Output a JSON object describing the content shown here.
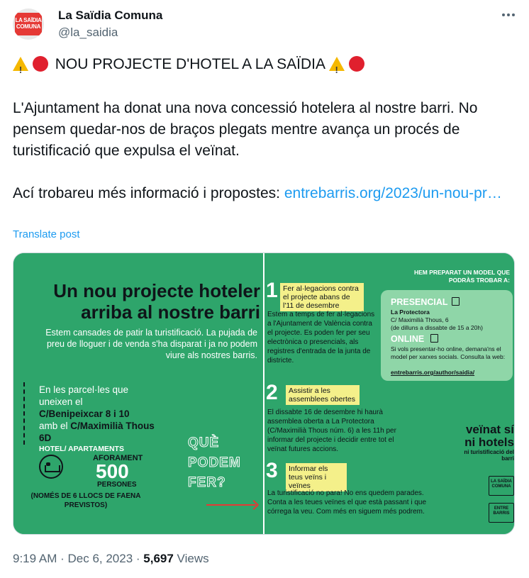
{
  "author": {
    "display_name": "La Saïdia Comuna",
    "handle": "@la_saidia",
    "avatar_text": "LA SAÏDIA COMUNA"
  },
  "post": {
    "title": "NOU PROJECTE D'HOTEL A LA SAÏDIA",
    "paragraph1": "L'Ajuntament ha donat una nova concessió hotelera al nostre barri. No pensem quedar-nos de braços plegats mentre avança un procés de turistificació que expulsa el veïnat.",
    "paragraph2_prefix": "Ací trobareu més informació i propostes: ",
    "link_text": "entrebarris.org/2023/un-nou-pr…",
    "translate_label": "Translate post"
  },
  "image": {
    "left": {
      "title_line1": "Un nou projecte hoteler",
      "title_line2": "arriba al nostre barri",
      "intro": "Estem cansades de patir la turistificació. La pujada de preu de lloguer i de venda s'ha disparat i ja no podem viure als nostres barris.",
      "loc_intro": "En les parcel·les que uneixen el",
      "loc_street1": "C/Benipeixcar 8 i 10",
      "loc_amb": "amb el",
      "loc_street2": "C/Maximilià Thous 6D",
      "hotel_label": "HOTEL/ APARTAMENTS",
      "aforament": "AFORAMENT",
      "count": "500",
      "persones": "PERSONES",
      "jobs": "(NOMÉS DE 6 LLOCS DE FAENA PREVISTOS)",
      "que1": "QUÈ",
      "que2": "PODEM",
      "que3": "FER?"
    },
    "right": {
      "hem": "HEM PREPARAT UN MODEL QUE PODRÀS TROBAR A:",
      "step1_num": "1",
      "step1_tag": "Fer al·legacions contra el projecte abans de l'11 de desembre",
      "step1_text": "Estem a temps de fer al·legacions a l'Ajuntament de València contra el projecte. Es poden fer per seu electrònica o presencials, als registres d'entrada de la junta de districte.",
      "step2_num": "2",
      "step2_tag": "Assistir a les assemblees obertes",
      "step2_text": "El dissabte 16 de desembre hi haurà assemblea oberta a La Protectora (C/Maximilià Thous núm. 6) a les 11h per informar del projecte i decidir entre tot el veïnat futures accions.",
      "step3_num": "3",
      "step3_tag": "Informar els teus veïns i veïnes",
      "step3_text": "La turistificació no para! No ens quedem parades. Conta a les teues veïnes el que està passant i que córrega la veu. Com més en siguem més podrem.",
      "presencial_h": "PRESENCIAL",
      "presencial_t1": "La Protectora",
      "presencial_t2": "C/ Maximilià Thous, 6",
      "presencial_t3": "(de dilluns a dissabte de 15 a 20h)",
      "online_h": "ONLINE",
      "online_t": "Si vols presentar-ho online, demana'ns el model per xarxes socials. Consulta la web:",
      "online_link": "entrebarris.org/author/saidia/",
      "veinat1": "veïnat sí",
      "veinat2": "ni hotels",
      "veinat3": "ni turistificació del barri",
      "logo1": "LA SAÏDIA COMUNA",
      "logo2": "ENTRE BARRIS"
    }
  },
  "meta": {
    "time": "9:19 AM",
    "sep": " · ",
    "date": "Dec 6, 2023",
    "views_count": "5,697",
    "views_label": " Views"
  },
  "colors": {
    "accent": "#1d9bf0",
    "poster_green": "#2ea56b",
    "warning_yellow": "#f5b800",
    "red": "#e0202e"
  }
}
